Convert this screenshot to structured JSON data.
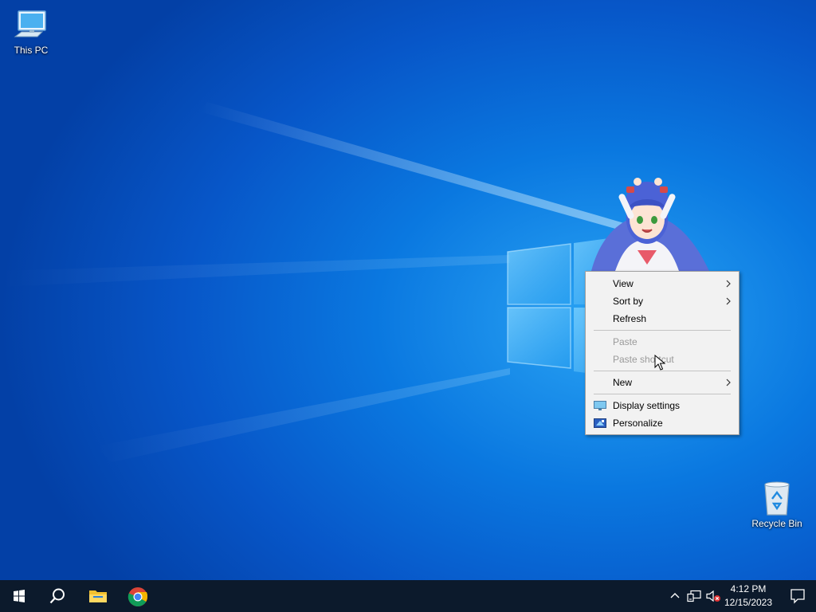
{
  "desktop": {
    "icons": [
      {
        "label": "This PC",
        "icon": "computer-icon"
      },
      {
        "label": "Recycle Bin",
        "icon": "recycle-bin-icon"
      }
    ]
  },
  "context_menu": {
    "items": [
      {
        "label": "View",
        "has_submenu": true,
        "enabled": true
      },
      {
        "label": "Sort by",
        "has_submenu": true,
        "enabled": true
      },
      {
        "label": "Refresh",
        "has_submenu": false,
        "enabled": true
      },
      {
        "label": "Paste",
        "has_submenu": false,
        "enabled": false
      },
      {
        "label": "Paste shortcut",
        "has_submenu": false,
        "enabled": false
      },
      {
        "label": "New",
        "has_submenu": true,
        "enabled": true
      },
      {
        "label": "Display settings",
        "has_submenu": false,
        "enabled": true,
        "icon": "display-icon"
      },
      {
        "label": "Personalize",
        "has_submenu": false,
        "enabled": true,
        "icon": "personalize-icon"
      }
    ]
  },
  "taskbar": {
    "pinned": [
      "windows-start-icon",
      "search-icon",
      "file-explorer-icon",
      "chrome-icon"
    ],
    "tray_icons": [
      "chevron-up-icon",
      "network-icon",
      "volume-muted-icon"
    ],
    "clock": {
      "time": "4:12 PM",
      "date": "12/15/2023"
    }
  },
  "colors": {
    "taskbar_bg": "#0c1a2c",
    "menu_bg": "#f2f2f2",
    "disabled_text": "#9a9a9a"
  }
}
